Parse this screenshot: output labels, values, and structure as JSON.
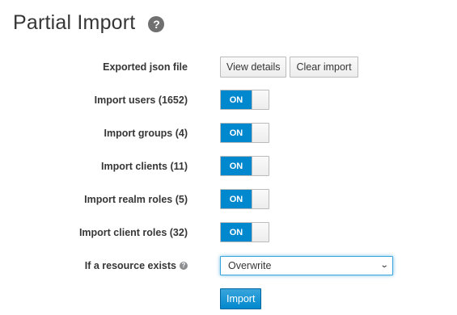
{
  "header": {
    "title": "Partial Import",
    "help_glyph": "?"
  },
  "form": {
    "file_row": {
      "label": "Exported json file",
      "view_details": "View details",
      "clear_import": "Clear import"
    },
    "toggles": [
      {
        "label": "Import users (1652)",
        "state": "ON"
      },
      {
        "label": "Import groups (4)",
        "state": "ON"
      },
      {
        "label": "Import clients (11)",
        "state": "ON"
      },
      {
        "label": "Import realm roles (5)",
        "state": "ON"
      },
      {
        "label": "Import client roles (32)",
        "state": "ON"
      }
    ],
    "resource_row": {
      "label": "If a resource exists",
      "help_glyph": "?",
      "selected": "Overwrite"
    },
    "submit_label": "Import"
  },
  "colors": {
    "primary": "#0088ce",
    "focus": "#39a5dc"
  }
}
